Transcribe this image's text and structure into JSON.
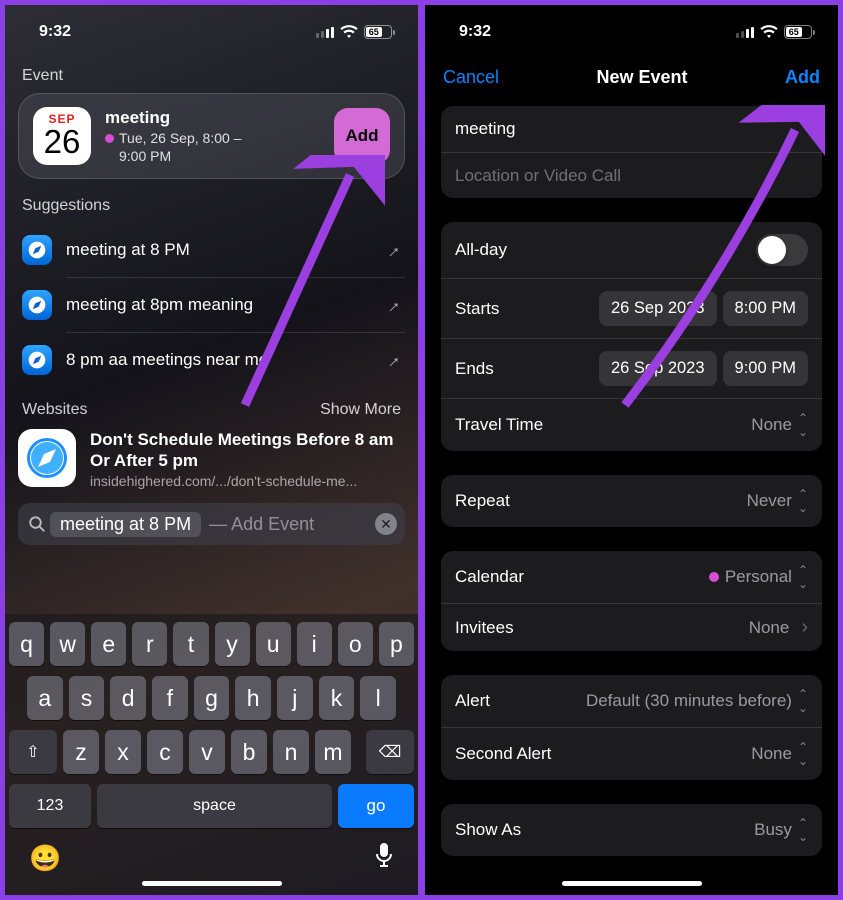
{
  "status": {
    "time": "9:32",
    "battery": "65"
  },
  "left": {
    "section_event": "Event",
    "event": {
      "month": "SEP",
      "day": "26",
      "title": "meeting",
      "subtitle1": "Tue, 26 Sep, 8:00 –",
      "subtitle2": "9:00 PM",
      "add": "Add"
    },
    "section_sugg": "Suggestions",
    "suggestions": [
      {
        "text": "meeting at 8 PM"
      },
      {
        "text": "meeting at 8pm meaning"
      },
      {
        "text": "8 pm aa meetings near me"
      }
    ],
    "websites_label": "Websites",
    "show_more": "Show More",
    "web_title": "Don't Schedule Meetings Before 8 am Or After 5 pm",
    "web_url": "insidehighered.com/.../don't-schedule-me...",
    "search_text": "meeting at 8 PM",
    "search_hint": "— Add Event",
    "keys_r1": [
      "q",
      "w",
      "e",
      "r",
      "t",
      "y",
      "u",
      "i",
      "o",
      "p"
    ],
    "keys_r2": [
      "a",
      "s",
      "d",
      "f",
      "g",
      "h",
      "j",
      "k",
      "l"
    ],
    "keys_r3": [
      "z",
      "x",
      "c",
      "v",
      "b",
      "n",
      "m"
    ],
    "k123": "123",
    "kspace": "space",
    "kgo": "go"
  },
  "right": {
    "cancel": "Cancel",
    "title": "New Event",
    "add": "Add",
    "event_title": "meeting",
    "location_ph": "Location or Video Call",
    "allday": "All-day",
    "starts": "Starts",
    "starts_date": "26 Sep 2023",
    "starts_time": "8:00 PM",
    "ends": "Ends",
    "ends_date": "26 Sep 2023",
    "ends_time": "9:00 PM",
    "travel": "Travel Time",
    "travel_val": "None",
    "repeat": "Repeat",
    "repeat_val": "Never",
    "calendar": "Calendar",
    "calendar_val": "Personal",
    "invitees": "Invitees",
    "invitees_val": "None",
    "alert": "Alert",
    "alert_val": "Default (30 minutes before)",
    "second_alert": "Second Alert",
    "second_alert_val": "None",
    "show_as": "Show As",
    "show_as_val": "Busy"
  }
}
